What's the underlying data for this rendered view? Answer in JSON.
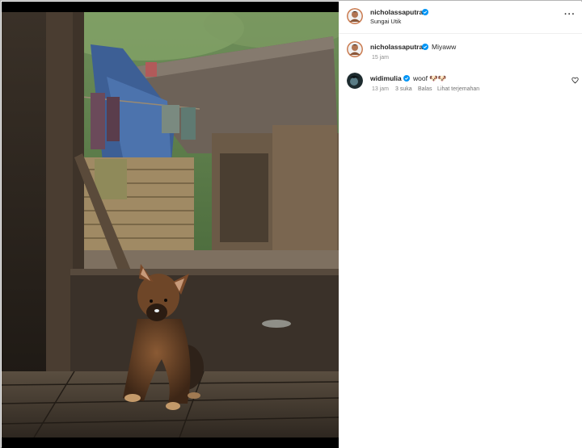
{
  "post": {
    "author": "nicholassaputra",
    "location": "Sungai Utik",
    "verified_color": "#0095f6"
  },
  "comments": [
    {
      "username": "nicholassaputra",
      "text": "Miyaww",
      "time": "15 jam",
      "verified": true
    },
    {
      "username": "widimulia",
      "text": "woof 🐶🐶",
      "time": "13 jam",
      "likes": "3 suka",
      "reply": "Balas",
      "translate": "Lihat terjemahan",
      "verified": true
    }
  ],
  "icons": {
    "more": "more-options-icon",
    "heart": "heart-outline-icon",
    "verified": "verified-badge-icon"
  }
}
